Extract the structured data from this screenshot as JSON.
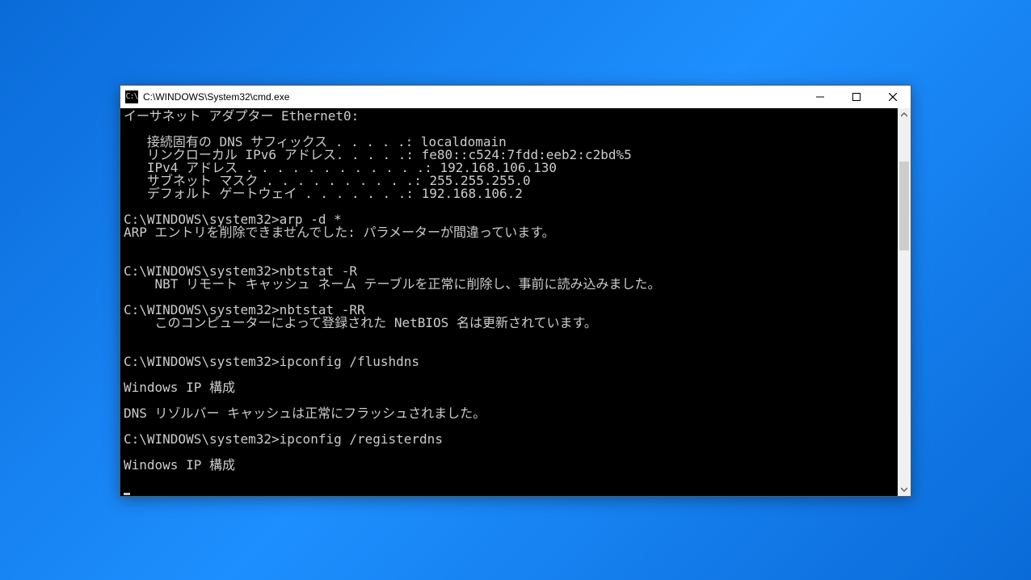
{
  "window": {
    "title": "C:\\WINDOWS\\System32\\cmd.exe",
    "app_icon_text": "C:\\"
  },
  "terminal_lines": [
    "イーサネット アダプター Ethernet0:",
    "",
    "   接続固有の DNS サフィックス . . . . .: localdomain",
    "   リンクローカル IPv6 アドレス. . . . .: fe80::c524:7fdd:eeb2:c2bd%5",
    "   IPv4 アドレス . . . . . . . . . . . .: 192.168.106.130",
    "   サブネット マスク . . . . . . . . . .: 255.255.255.0",
    "   デフォルト ゲートウェイ . . . . . . .: 192.168.106.2",
    "",
    "C:\\WINDOWS\\system32>arp -d *",
    "ARP エントリを削除できませんでした: パラメーターが間違っています。",
    "",
    "",
    "C:\\WINDOWS\\system32>nbtstat -R",
    "    NBT リモート キャッシュ ネーム テーブルを正常に削除し、事前に読み込みました。",
    "",
    "C:\\WINDOWS\\system32>nbtstat -RR",
    "    このコンピューターによって登録された NetBIOS 名は更新されています。",
    "",
    "",
    "C:\\WINDOWS\\system32>ipconfig /flushdns",
    "",
    "Windows IP 構成",
    "",
    "DNS リゾルバー キャッシュは正常にフラッシュされました。",
    "",
    "C:\\WINDOWS\\system32>ipconfig /registerdns",
    "",
    "Windows IP 構成",
    ""
  ]
}
